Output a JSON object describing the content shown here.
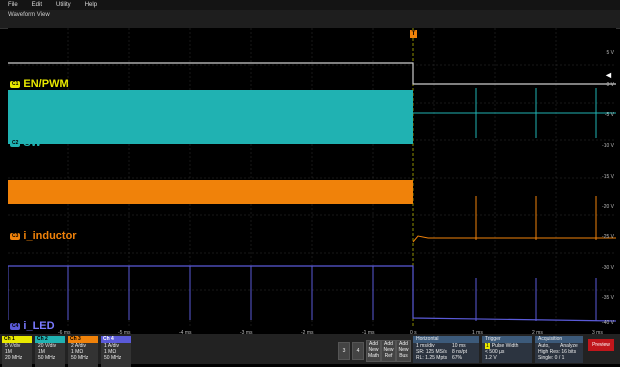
{
  "menu": [
    "File",
    "Edit",
    "Utility",
    "Help"
  ],
  "view_title": "Waveform View",
  "trigger_marker": "T",
  "channels": [
    {
      "badge": "C1",
      "name": "EN/PWM",
      "color": "#e8e800"
    },
    {
      "badge": "C2",
      "name": "SW",
      "color": "#20b2b2"
    },
    {
      "badge": "C3",
      "name": "i_inductor",
      "color": "#f0820a"
    },
    {
      "badge": "C4",
      "name": "i_LED",
      "color": "#5a5ad8"
    }
  ],
  "y_labels": [
    "5 V",
    "0 V",
    "-5 V",
    "-10 V",
    "-15 V",
    "-20 V",
    "-25 V",
    "-30 V",
    "-35 V",
    "-40 V"
  ],
  "x_labels": [
    "-6 ms",
    "-5 ms",
    "-4 ms",
    "-3 ms",
    "-2 ms",
    "-1 ms",
    "0 s",
    "1 ms",
    "2 ms",
    "3 ms"
  ],
  "channel_boxes": [
    {
      "hdr": "Ch 1",
      "l1": "5 V/div",
      "l2": "1M",
      "l3": "20 MHz",
      "color": "#e8e800"
    },
    {
      "hdr": "Ch 2",
      "l1": "20 V/div",
      "l2": "1M",
      "l3": "50 MHz",
      "color": "#20b2b2"
    },
    {
      "hdr": "Ch 3",
      "l1": "2 A/div",
      "l2": "1 MΩ",
      "l3": "50 MHz",
      "color": "#f0820a"
    },
    {
      "hdr": "Ch 4",
      "l1": "1 A/div",
      "l2": "1 MΩ",
      "l3": "50 MHz",
      "color": "#5a5ad8"
    }
  ],
  "buttons": {
    "b3": "3",
    "b4": "4",
    "add_math": "Add New Math",
    "add_ref": "Add New Ref",
    "add_bus": "Add New Bus"
  },
  "horizontal": {
    "title": "Horizontal",
    "r1a": "1 ms/div",
    "r1b": "10 ms",
    "r2a": "SR: 125 MS/s",
    "r2b": "8 ns/pt",
    "r3a": "RL: 1.25 Mpts",
    "r3b": "67%"
  },
  "trigger": {
    "title": "Trigger",
    "r1": "Pulse Width",
    "r2": "< 500 µs",
    "r3": "1.2 V"
  },
  "acquisition": {
    "title": "Acquisition",
    "r1a": "Auto,",
    "r1b": "Analyze",
    "r2": "High Res: 16 bits",
    "r3": "Single: 0 / 1"
  },
  "preview_label": "Preview"
}
